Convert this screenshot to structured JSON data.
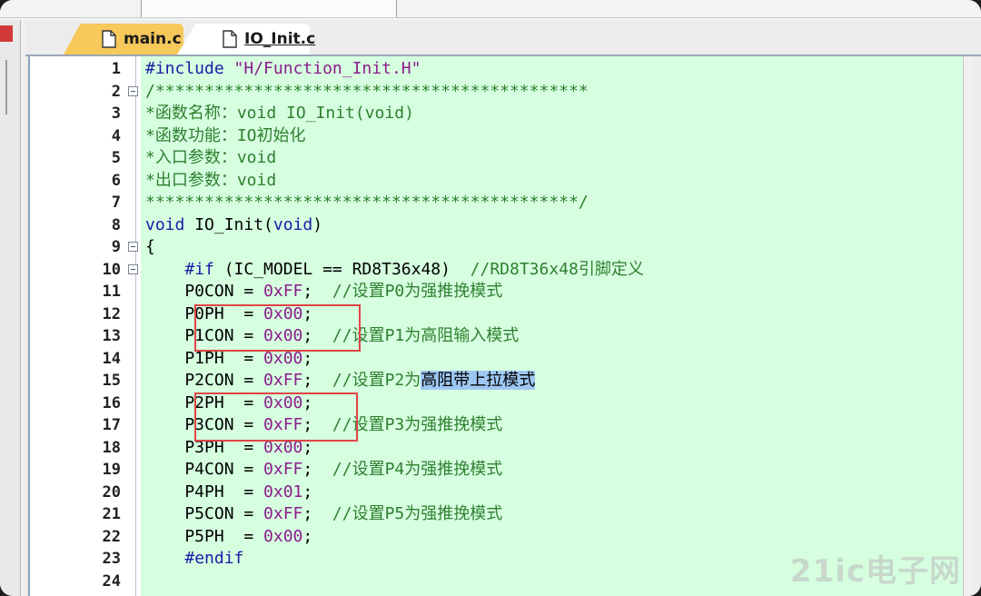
{
  "tabs": [
    {
      "label": "main.c",
      "active": false
    },
    {
      "label": "IO_Init.c",
      "active": true
    }
  ],
  "editor": {
    "lines": [
      {
        "n": "1",
        "tokens": [
          {
            "t": "#include ",
            "c": "prep"
          },
          {
            "t": "\"H/Function_Init.H\"",
            "c": "str"
          }
        ]
      },
      {
        "n": "2",
        "fold": true,
        "tokens": [
          {
            "t": "/********************************************",
            "c": "cmt"
          }
        ]
      },
      {
        "n": "3",
        "tokens": [
          {
            "t": "*函数名称：void IO_Init(void)",
            "c": "cmt"
          }
        ]
      },
      {
        "n": "4",
        "tokens": [
          {
            "t": "*函数功能：IO初始化",
            "c": "cmt"
          }
        ]
      },
      {
        "n": "5",
        "tokens": [
          {
            "t": "*入口参数：void",
            "c": "cmt"
          }
        ]
      },
      {
        "n": "6",
        "tokens": [
          {
            "t": "*出口参数：void",
            "c": "cmt"
          }
        ]
      },
      {
        "n": "7",
        "tokens": [
          {
            "t": "********************************************/",
            "c": "cmt"
          }
        ]
      },
      {
        "n": "8",
        "tokens": [
          {
            "t": "void",
            "c": "kw"
          },
          {
            "t": " IO_Init(",
            "c": ""
          },
          {
            "t": "void",
            "c": "kw"
          },
          {
            "t": ")",
            "c": ""
          }
        ]
      },
      {
        "n": "9",
        "fold": true,
        "tokens": [
          {
            "t": "{",
            "c": ""
          }
        ]
      },
      {
        "n": "10",
        "fold": true,
        "tokens": [
          {
            "t": "    ",
            "c": ""
          },
          {
            "t": "#if",
            "c": "prep"
          },
          {
            "t": " (IC_MODEL == RD8T36x48)  ",
            "c": ""
          },
          {
            "t": "//RD8T36x48引脚定义",
            "c": "cmt"
          }
        ]
      },
      {
        "n": "11",
        "tokens": [
          {
            "t": "    P0CON = ",
            "c": ""
          },
          {
            "t": "0xFF",
            "c": "hex"
          },
          {
            "t": ";  ",
            "c": ""
          },
          {
            "t": "//设置P0为强推挽模式",
            "c": "cmt"
          }
        ]
      },
      {
        "n": "12",
        "tokens": [
          {
            "t": "    P0PH  = ",
            "c": ""
          },
          {
            "t": "0x00",
            "c": "hex"
          },
          {
            "t": ";",
            "c": ""
          }
        ]
      },
      {
        "n": "13",
        "tokens": [
          {
            "t": "    P1CON = ",
            "c": ""
          },
          {
            "t": "0x00",
            "c": "hex"
          },
          {
            "t": ";  ",
            "c": ""
          },
          {
            "t": "//设置P1为高阻输入模式",
            "c": "cmt"
          }
        ]
      },
      {
        "n": "14",
        "tokens": [
          {
            "t": "    P1PH  = ",
            "c": ""
          },
          {
            "t": "0x00",
            "c": "hex"
          },
          {
            "t": ";",
            "c": ""
          }
        ]
      },
      {
        "n": "15",
        "tokens": [
          {
            "t": "    P2CON = ",
            "c": ""
          },
          {
            "t": "0xFF",
            "c": "hex"
          },
          {
            "t": ";  ",
            "c": ""
          },
          {
            "t": "//设置P2为",
            "c": "cmt"
          },
          {
            "t": "高阻带上拉模式",
            "c": "mark"
          }
        ]
      },
      {
        "n": "16",
        "tokens": [
          {
            "t": "    P2PH  = ",
            "c": ""
          },
          {
            "t": "0x00",
            "c": "hex"
          },
          {
            "t": ";",
            "c": ""
          }
        ]
      },
      {
        "n": "17",
        "tokens": [
          {
            "t": "    P3CON = ",
            "c": ""
          },
          {
            "t": "0xFF",
            "c": "hex"
          },
          {
            "t": ";  ",
            "c": ""
          },
          {
            "t": "//设置P3为强推挽模式",
            "c": "cmt"
          }
        ]
      },
      {
        "n": "18",
        "tokens": [
          {
            "t": "    P3PH  = ",
            "c": ""
          },
          {
            "t": "0x00",
            "c": "hex"
          },
          {
            "t": ";",
            "c": ""
          }
        ]
      },
      {
        "n": "19",
        "tokens": [
          {
            "t": "    P4CON = ",
            "c": ""
          },
          {
            "t": "0xFF",
            "c": "hex"
          },
          {
            "t": ";  ",
            "c": ""
          },
          {
            "t": "//设置P4为强推挽模式",
            "c": "cmt"
          }
        ]
      },
      {
        "n": "20",
        "tokens": [
          {
            "t": "    P4PH  = ",
            "c": ""
          },
          {
            "t": "0x01",
            "c": "hex"
          },
          {
            "t": ";",
            "c": ""
          }
        ]
      },
      {
        "n": "21",
        "tokens": [
          {
            "t": "    P5CON = ",
            "c": ""
          },
          {
            "t": "0xFF",
            "c": "hex"
          },
          {
            "t": ";  ",
            "c": ""
          },
          {
            "t": "//设置P5为强推挽模式",
            "c": "cmt"
          }
        ]
      },
      {
        "n": "22",
        "tokens": [
          {
            "t": "    P5PH  = ",
            "c": ""
          },
          {
            "t": "0x00",
            "c": "hex"
          },
          {
            "t": ";",
            "c": ""
          }
        ]
      },
      {
        "n": "23",
        "tokens": [
          {
            "t": "    ",
            "c": ""
          },
          {
            "t": "#endif",
            "c": "prep"
          }
        ]
      },
      {
        "n": "24",
        "tokens": []
      }
    ]
  },
  "watermark": "21ic电子网",
  "colors": {
    "editor_bg": "#d6ffe0",
    "tab_inactive": "#f7c85a",
    "annotation_box": "#e04545",
    "selection": "#9ec8f2"
  }
}
